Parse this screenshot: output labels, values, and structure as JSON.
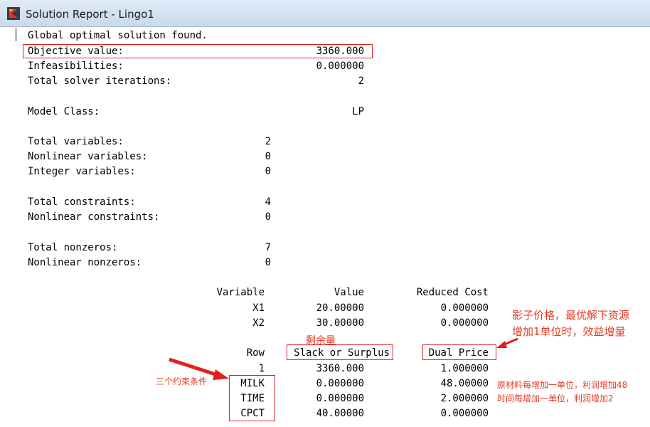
{
  "window": {
    "title": "Solution Report - Lingo1"
  },
  "colors": {
    "annotation_red": "#e53b1f",
    "titlebar": "#d4e1f1"
  },
  "report": {
    "status_line": "Global optimal solution found.",
    "summary": [
      {
        "label": "Objective value:",
        "value": "3360.000"
      },
      {
        "label": "Infeasibilities:",
        "value": "0.000000"
      },
      {
        "label": "Total solver iterations:",
        "value": "2"
      }
    ],
    "model_class": {
      "label": "Model Class:",
      "value": "LP"
    },
    "variable_counts": [
      {
        "label": "Total variables:",
        "value": "2"
      },
      {
        "label": "Nonlinear variables:",
        "value": "0"
      },
      {
        "label": "Integer variables:",
        "value": "0"
      }
    ],
    "constraint_counts": [
      {
        "label": "Total constraints:",
        "value": "4"
      },
      {
        "label": "Nonlinear constraints:",
        "value": "0"
      }
    ],
    "nonzero_counts": [
      {
        "label": "Total nonzeros:",
        "value": "7"
      },
      {
        "label": "Nonlinear nonzeros:",
        "value": "0"
      }
    ],
    "variables_table": {
      "headers": [
        "Variable",
        "Value",
        "Reduced Cost"
      ],
      "rows": [
        [
          "X1",
          "20.00000",
          "0.000000"
        ],
        [
          "X2",
          "30.00000",
          "0.000000"
        ]
      ]
    },
    "rows_table": {
      "headers": [
        "Row",
        "Slack or Surplus",
        "Dual Price"
      ],
      "rows": [
        [
          "1",
          "3360.000",
          "1.000000"
        ],
        [
          "MILK",
          "0.000000",
          "48.00000"
        ],
        [
          "TIME",
          "0.000000",
          "2.000000"
        ],
        [
          "CPCT",
          "40.00000",
          "0.000000"
        ]
      ]
    }
  },
  "annotations": {
    "slack_label": "剩余量",
    "dual_price_note_line1": "影子价格，最优解下资源",
    "dual_price_note_line2": "增加1单位时，效益增量",
    "constraints_note": "三个约束条件",
    "milk_note": "原材料每增加一单位，利润增加48",
    "time_note": "时间每增加一单位，利润增加2"
  }
}
